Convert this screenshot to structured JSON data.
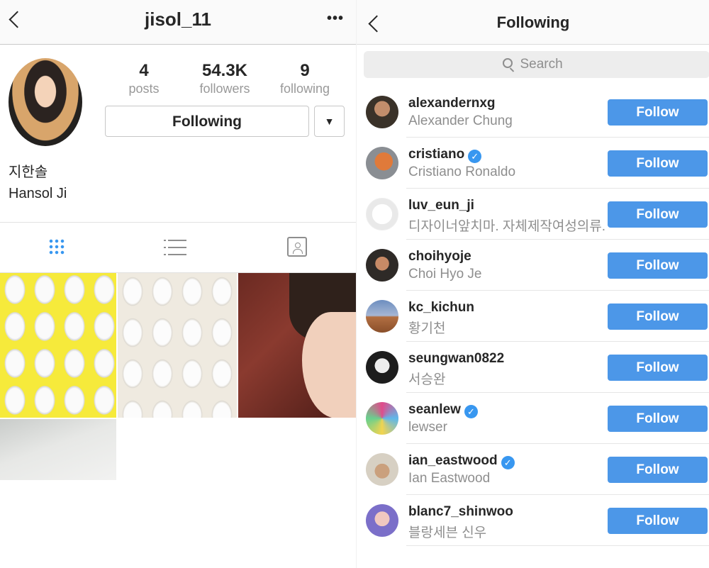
{
  "profile": {
    "username": "jisol_11",
    "more_label": "•••",
    "stats": {
      "posts_count": "4",
      "posts_label": "posts",
      "followers_count": "54.3K",
      "followers_label": "followers",
      "following_count": "9",
      "following_label": "following"
    },
    "following_button": "Following",
    "dropdown_symbol": "▼",
    "name_korean": "지한솔",
    "name_english": "Hansol Ji",
    "tabs": [
      "grid",
      "list",
      "tagged"
    ],
    "posts": [
      "bichon-yellow-pattern",
      "bichon-cream-pattern",
      "selfie",
      "snow"
    ]
  },
  "following": {
    "title": "Following",
    "search_placeholder": "Search",
    "items": [
      {
        "username": "alexandernxg",
        "name": "Alexander Chung",
        "verified": false,
        "button": "Follow"
      },
      {
        "username": "cristiano",
        "name": "Cristiano Ronaldo",
        "verified": true,
        "button": "Follow"
      },
      {
        "username": "luv_eun_ji",
        "name": "디자이너앞치마. 자체제작여성의류.",
        "verified": false,
        "button": "Follow"
      },
      {
        "username": "choihyoje",
        "name": "Choi Hyo Je",
        "verified": false,
        "button": "Follow"
      },
      {
        "username": "kc_kichun",
        "name": "황기천",
        "verified": false,
        "button": "Follow"
      },
      {
        "username": "seungwan0822",
        "name": "서승완",
        "verified": false,
        "button": "Follow"
      },
      {
        "username": "seanlew",
        "name": "lewser",
        "verified": true,
        "button": "Follow"
      },
      {
        "username": "ian_eastwood",
        "name": "Ian Eastwood",
        "verified": true,
        "button": "Follow"
      },
      {
        "username": "blanc7_shinwoo",
        "name": "블랑세븐 신우",
        "verified": false,
        "button": "Follow"
      }
    ]
  },
  "colors": {
    "accent": "#3897f0",
    "follow_button": "#4c97e8",
    "secondary_text": "#8e8e8e"
  }
}
